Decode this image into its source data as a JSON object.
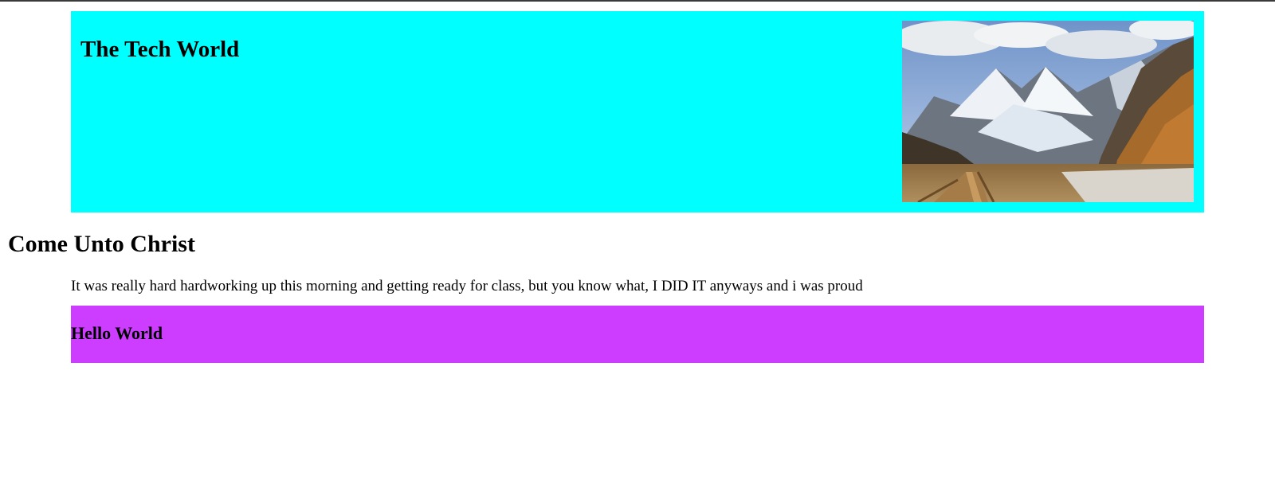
{
  "header": {
    "title": "The Tech World",
    "background": "#00ffff",
    "image_icon": "mountain-landscape-image"
  },
  "main": {
    "title": "Come Unto Christ",
    "paragraph": "It was really hard hardworking up this morning and getting ready for class, but you know what, I DID IT anyways and i was proud"
  },
  "banner": {
    "title": "Hello World",
    "background": "#cc3dff"
  }
}
